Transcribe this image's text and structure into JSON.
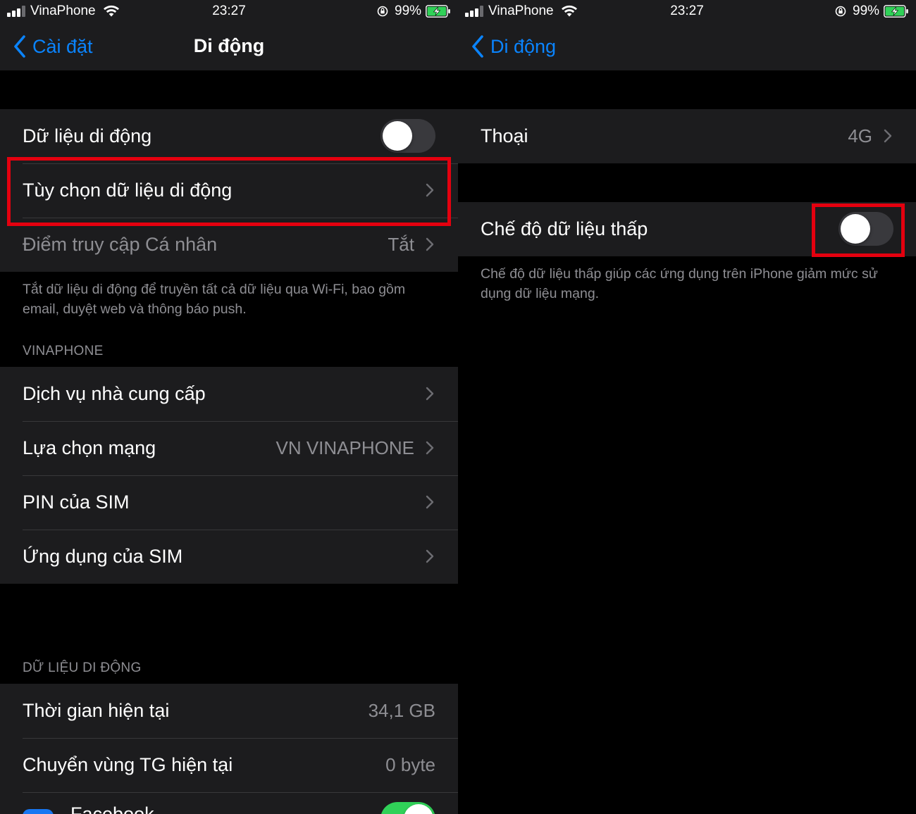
{
  "status_bar": {
    "carrier": "VinaPhone",
    "time": "23:27",
    "battery_percent": "99%",
    "icons": [
      "signal-icon",
      "wifi-icon",
      "orientation-lock-icon",
      "battery-charging-icon"
    ]
  },
  "colors": {
    "background": "#000000",
    "cell_background": "#1c1c1e",
    "accent": "#0a84ff",
    "secondary_text": "#8e8e93",
    "highlight_box": "#e4000f"
  },
  "left": {
    "nav": {
      "back_label": "Cài đặt",
      "title": "Di động"
    },
    "group1": {
      "cellular_data": {
        "label": "Dữ liệu di động",
        "toggle_on": false
      },
      "cellular_options": {
        "label": "Tùy chọn dữ liệu di động"
      },
      "hotspot": {
        "label": "Điểm truy cập Cá nhân",
        "value": "Tắt"
      }
    },
    "group1_footer": "Tắt dữ liệu di động để truyền tất cả dữ liệu qua Wi-Fi, bao gồm email, duyệt web và thông báo push.",
    "section_vinaphone": {
      "header": "VINAPHONE",
      "items": [
        {
          "label": "Dịch vụ nhà cung cấp",
          "value": ""
        },
        {
          "label": "Lựa chọn mạng",
          "value": "VN VINAPHONE"
        },
        {
          "label": "PIN của SIM",
          "value": ""
        },
        {
          "label": "Ứng dụng của SIM",
          "value": ""
        }
      ]
    },
    "section_data": {
      "header": "DỮ LIỆU DI ĐỘNG",
      "items": [
        {
          "label": "Thời gian hiện tại",
          "value": "34,1 GB"
        },
        {
          "label": "Chuyển vùng TG hiện tại",
          "value": "0 byte"
        }
      ],
      "app_partial": {
        "label": "Facebook",
        "toggle_on": true
      }
    }
  },
  "right": {
    "nav": {
      "back_label": "Di động"
    },
    "voice": {
      "label": "Thoại",
      "value": "4G"
    },
    "low_data_mode": {
      "label": "Chế độ dữ liệu thấp",
      "toggle_on": false
    },
    "low_data_footer": "Chế độ dữ liệu thấp giúp các ứng dụng trên iPhone giảm mức sử dụng dữ liệu mạng."
  }
}
